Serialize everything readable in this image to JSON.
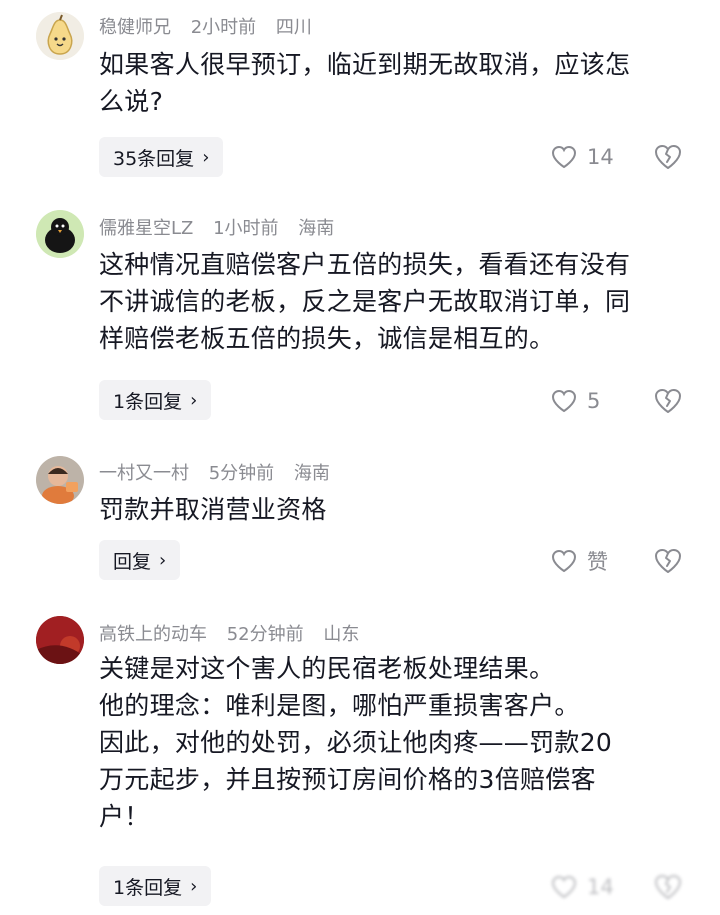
{
  "comments": [
    {
      "username": "稳健师兄",
      "time": "2小时前",
      "location": "四川",
      "text": "如果客人很早预订，临近到期无故取消，应该怎\n么说?",
      "reply_label": "35条回复",
      "like_count": "14",
      "avatar_icon": "pear-cartoon-avatar"
    },
    {
      "username": "儒雅星空LZ",
      "time": "1小时前",
      "location": "海南",
      "text": "这种情况直赔偿客户五倍的损失，看看还有没有\n不讲诚信的老板，反之是客户无故取消订单，同\n样赔偿老板五倍的损失，诚信是相互的。",
      "reply_label": "1条回复",
      "like_count": "5",
      "avatar_icon": "black-bird-avatar"
    },
    {
      "username": "一村又一村",
      "time": "5分钟前",
      "location": "海南",
      "text": "罚款并取消营业资格",
      "reply_label": "回复",
      "like_count": "赞",
      "avatar_icon": "child-photo-avatar"
    },
    {
      "username": "高铁上的动车",
      "time": "52分钟前",
      "location": "山东",
      "text": "关键是对这个害人的民宿老板处理结果。\n他的理念：唯利是图，哪怕严重损害客户。\n因此，对他的处罚，必须让他肉疼——罚款20\n万元起步，并且按预订房间价格的3倍赔偿客\n户！",
      "reply_label": "1条回复",
      "like_count": "14",
      "avatar_icon": "red-photo-avatar"
    }
  ],
  "icons": {
    "like": "heart-outline-icon",
    "dislike": "broken-heart-icon",
    "chevron": "chevron-right-icon"
  },
  "colors": {
    "text": "#161823",
    "meta": "#8a8b91",
    "reply_bg": "#f2f2f4"
  }
}
